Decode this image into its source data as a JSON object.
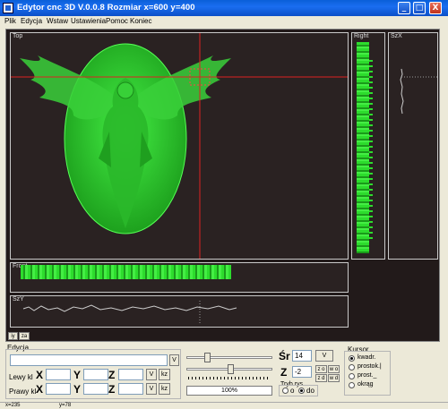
{
  "window": {
    "title": "Edytor cnc 3D V.0.0.8 Rozmiar x=600 y=400",
    "minimize": "_",
    "maximize": "□",
    "close": "X"
  },
  "menu": [
    "Plik",
    "Edycja",
    "Wstaw",
    "Ustawienia",
    "Pomoc",
    "Koniec"
  ],
  "views": {
    "top": "Top",
    "right": "Right",
    "szx": "SzX",
    "front": "Front",
    "szy": "SzY"
  },
  "mini_buttons": [
    "iy",
    "za"
  ],
  "edycja": {
    "group_label": "Edycja",
    "v_button": "V",
    "lewy_label": "Lewy kl",
    "prawy_label": "Prawy kl",
    "x": "X",
    "y": "Y",
    "z": "Z",
    "kz": "kz"
  },
  "tool": {
    "sr_label": "Śr",
    "sr_value": "14",
    "v_button": "V",
    "z_label": "Z",
    "z_value": "-2",
    "z_o": "z o",
    "w_o": "w o",
    "z_d": "z d",
    "w_d": "w d",
    "tryb_label": "Tryb rys",
    "tryb_o": "o",
    "tryb_do": "do",
    "progress_label": "100%",
    "progress_value": 1.0
  },
  "kursor": {
    "label": "Kursor",
    "options": [
      "kwadr.",
      "prostok.|",
      "prost._",
      "okrąg"
    ],
    "selected": 0
  },
  "status": {
    "left": "x=235",
    "mid": "y=78"
  },
  "colors": {
    "canvas_bg": "#221a1a",
    "shape_green": "#22cc22",
    "crosshair": "#dd2222"
  }
}
